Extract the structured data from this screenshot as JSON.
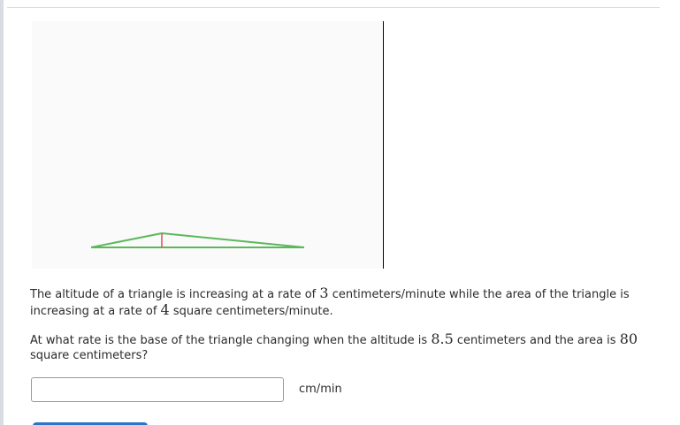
{
  "question": {
    "p1_part1": "The altitude of a triangle is increasing at a rate of ",
    "altitude_rate": "3",
    "p1_part2": " centimeters/minute while the area of the triangle is increasing at a rate of ",
    "area_rate": "4",
    "p1_part3": " square centimeters/minute.",
    "p2_part1": "At what rate is the base of the triangle changing when the altitude is ",
    "altitude_value": "8.5",
    "p2_part2": " centimeters and the area is ",
    "area_value": "80",
    "p2_part3": " square centimeters?"
  },
  "answer": {
    "value": "",
    "placeholder": "",
    "unit": "cm/min"
  },
  "colors": {
    "triangle": "#5cb85c",
    "altitude": "#d9534f",
    "submit": "#2a74c9"
  }
}
